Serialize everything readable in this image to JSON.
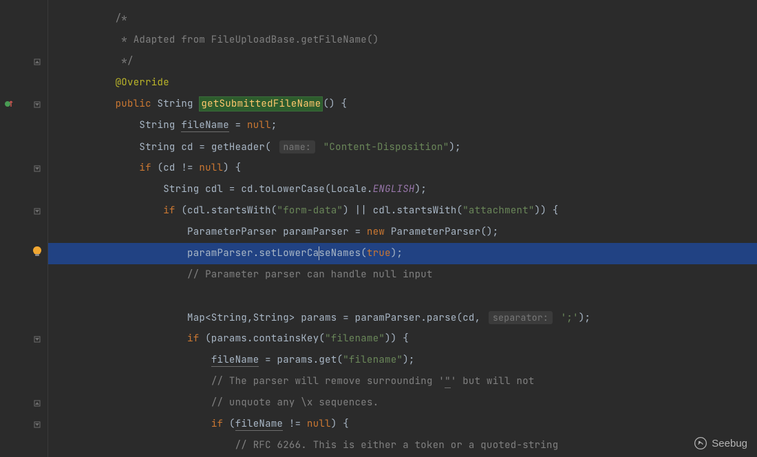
{
  "watermark": "Seebug",
  "lines": [
    {
      "indent": 2,
      "tokens": [
        {
          "t": "/*",
          "c": "c-comment"
        }
      ],
      "gutter": null
    },
    {
      "indent": 2,
      "tokens": [
        {
          "t": " * Adapted from FileUploadBase.getFileName()",
          "c": "c-comment"
        }
      ],
      "gutter": null
    },
    {
      "indent": 2,
      "tokens": [
        {
          "t": " */",
          "c": "c-comment"
        }
      ],
      "gutter": "fold-up"
    },
    {
      "indent": 2,
      "tokens": [
        {
          "t": "@Override",
          "c": "c-annotation"
        }
      ],
      "gutter": null
    },
    {
      "indent": 2,
      "tokens": [
        {
          "t": "public ",
          "c": "c-keyword"
        },
        {
          "t": "String ",
          "c": "c-type"
        },
        {
          "t": "getSubmittedFileName",
          "c": "c-method-def"
        },
        {
          "t": "() {",
          "c": ""
        }
      ],
      "gutter": "fold-down",
      "leftmark": "change"
    },
    {
      "indent": 3,
      "tokens": [
        {
          "t": "String ",
          "c": "c-type"
        },
        {
          "t": "fileName",
          "c": "c-var c-underline"
        },
        {
          "t": " = ",
          "c": ""
        },
        {
          "t": "null",
          "c": "c-keyword"
        },
        {
          "t": ";",
          "c": ""
        }
      ],
      "gutter": null
    },
    {
      "indent": 3,
      "tokens": [
        {
          "t": "String ",
          "c": "c-type"
        },
        {
          "t": "cd",
          "c": "c-var"
        },
        {
          "t": " = getHeader( ",
          "c": ""
        },
        {
          "t": "name:",
          "c": "c-param-hint"
        },
        {
          "t": " ",
          "c": ""
        },
        {
          "t": "\"Content-Disposition\"",
          "c": "c-string"
        },
        {
          "t": ");",
          "c": ""
        }
      ],
      "gutter": null
    },
    {
      "indent": 3,
      "tokens": [
        {
          "t": "if ",
          "c": "c-keyword"
        },
        {
          "t": "(cd != ",
          "c": ""
        },
        {
          "t": "null",
          "c": "c-keyword"
        },
        {
          "t": ") {",
          "c": ""
        }
      ],
      "gutter": "fold-down"
    },
    {
      "indent": 4,
      "tokens": [
        {
          "t": "String ",
          "c": "c-type"
        },
        {
          "t": "cdl",
          "c": "c-var"
        },
        {
          "t": " = cd.toLowerCase(Locale.",
          "c": ""
        },
        {
          "t": "ENGLISH",
          "c": "c-const"
        },
        {
          "t": ");",
          "c": ""
        }
      ],
      "gutter": null
    },
    {
      "indent": 4,
      "tokens": [
        {
          "t": "if ",
          "c": "c-keyword"
        },
        {
          "t": "(cdl.startsWith(",
          "c": ""
        },
        {
          "t": "\"form-data\"",
          "c": "c-string"
        },
        {
          "t": ") || cdl.startsWith(",
          "c": ""
        },
        {
          "t": "\"attachment\"",
          "c": "c-string"
        },
        {
          "t": ")) {",
          "c": ""
        }
      ],
      "gutter": "fold-down"
    },
    {
      "indent": 5,
      "tokens": [
        {
          "t": "ParameterParser ",
          "c": "c-type"
        },
        {
          "t": "paramParser",
          "c": "c-var"
        },
        {
          "t": " = ",
          "c": ""
        },
        {
          "t": "new ",
          "c": "c-new"
        },
        {
          "t": "ParameterParser();",
          "c": ""
        }
      ],
      "gutter": null
    },
    {
      "indent": 5,
      "highlighted": true,
      "tokens": [
        {
          "t": "paramParser.setLowerCa",
          "c": ""
        },
        {
          "t": "",
          "c": "",
          "cursor": true
        },
        {
          "t": "seNames(",
          "c": ""
        },
        {
          "t": "true",
          "c": "c-true"
        },
        {
          "t": ");",
          "c": ""
        }
      ],
      "gutter": "bulb"
    },
    {
      "indent": 5,
      "tokens": [
        {
          "t": "// Parameter parser can handle null input",
          "c": "c-comment"
        }
      ],
      "gutter": null
    },
    {
      "indent": 5,
      "tokens": [],
      "gutter": null
    },
    {
      "indent": 5,
      "tokens": [
        {
          "t": "Map<String,String> ",
          "c": "c-type"
        },
        {
          "t": "params",
          "c": "c-var"
        },
        {
          "t": " = paramParser.parse(cd, ",
          "c": ""
        },
        {
          "t": "separator:",
          "c": "c-param-hint"
        },
        {
          "t": " ",
          "c": ""
        },
        {
          "t": "';'",
          "c": "c-string"
        },
        {
          "t": ");",
          "c": ""
        }
      ],
      "gutter": null
    },
    {
      "indent": 5,
      "tokens": [
        {
          "t": "if ",
          "c": "c-keyword"
        },
        {
          "t": "(params.containsKey(",
          "c": ""
        },
        {
          "t": "\"filename\"",
          "c": "c-string"
        },
        {
          "t": ")) {",
          "c": ""
        }
      ],
      "gutter": "fold-down"
    },
    {
      "indent": 6,
      "tokens": [
        {
          "t": "fileName",
          "c": "c-var c-underline"
        },
        {
          "t": " = params.get(",
          "c": ""
        },
        {
          "t": "\"filename\"",
          "c": "c-string"
        },
        {
          "t": ");",
          "c": ""
        }
      ],
      "gutter": null
    },
    {
      "indent": 6,
      "tokens": [
        {
          "t": "// The parser will remove surrounding '",
          "c": "c-comment"
        },
        {
          "t": "\"",
          "c": "c-comment c-underline"
        },
        {
          "t": "' but will not",
          "c": "c-comment"
        }
      ],
      "gutter": null
    },
    {
      "indent": 6,
      "tokens": [
        {
          "t": "// unquote any \\x sequences.",
          "c": "c-comment"
        }
      ],
      "gutter": "fold-up"
    },
    {
      "indent": 6,
      "tokens": [
        {
          "t": "if ",
          "c": "c-keyword"
        },
        {
          "t": "(",
          "c": ""
        },
        {
          "t": "fileName",
          "c": "c-var c-underline"
        },
        {
          "t": " != ",
          "c": ""
        },
        {
          "t": "null",
          "c": "c-keyword"
        },
        {
          "t": ") {",
          "c": ""
        }
      ],
      "gutter": "fold-down"
    },
    {
      "indent": 7,
      "tokens": [
        {
          "t": "// RFC 6266. This is either a token or a quoted-string",
          "c": "c-comment"
        }
      ],
      "gutter": null
    }
  ]
}
